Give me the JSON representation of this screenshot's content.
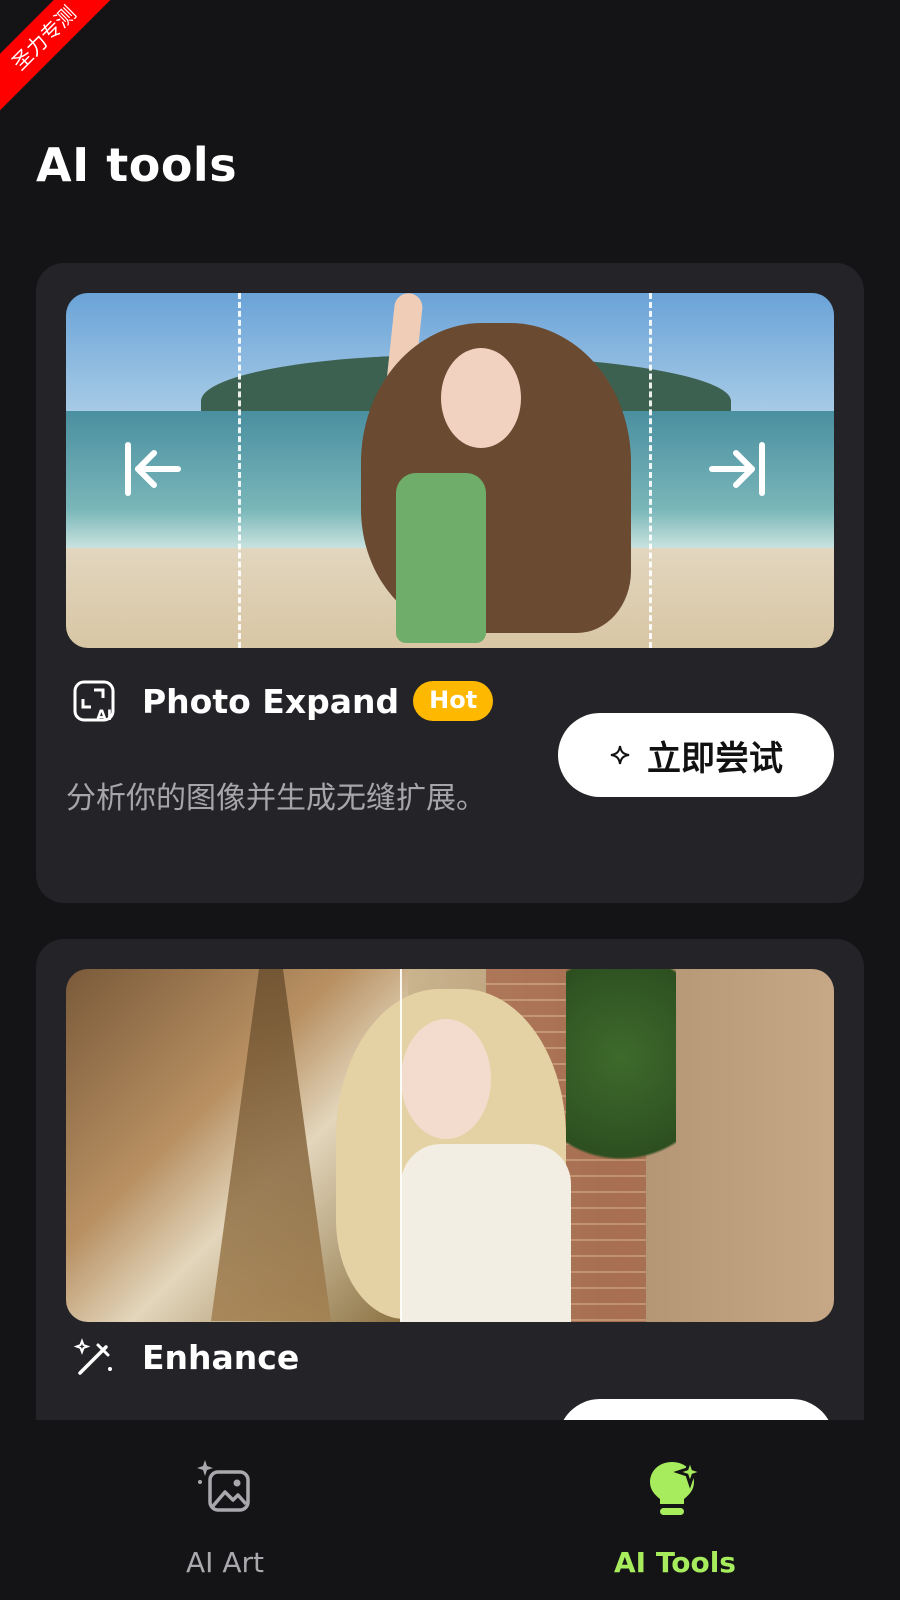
{
  "watermark": "圣力专测",
  "page": {
    "title": "AI tools"
  },
  "cards": [
    {
      "name": "Photo Expand",
      "badge": "Hot",
      "description": "分析你的图像并生成无缝扩展。",
      "button_label": "立即尝试",
      "icon": "expand-ai-icon"
    },
    {
      "name": "Enhance",
      "icon": "magic-wand-icon"
    }
  ],
  "bottom_nav": {
    "items": [
      {
        "label": "AI Art",
        "icon": "image-sparkle-icon",
        "active": false
      },
      {
        "label": "AI Tools",
        "icon": "bulb-sparkle-icon",
        "active": true
      }
    ]
  },
  "colors": {
    "background": "#141416",
    "card": "#242428",
    "hot_badge": "#ffb800",
    "active_nav": "#a6ec5d"
  }
}
